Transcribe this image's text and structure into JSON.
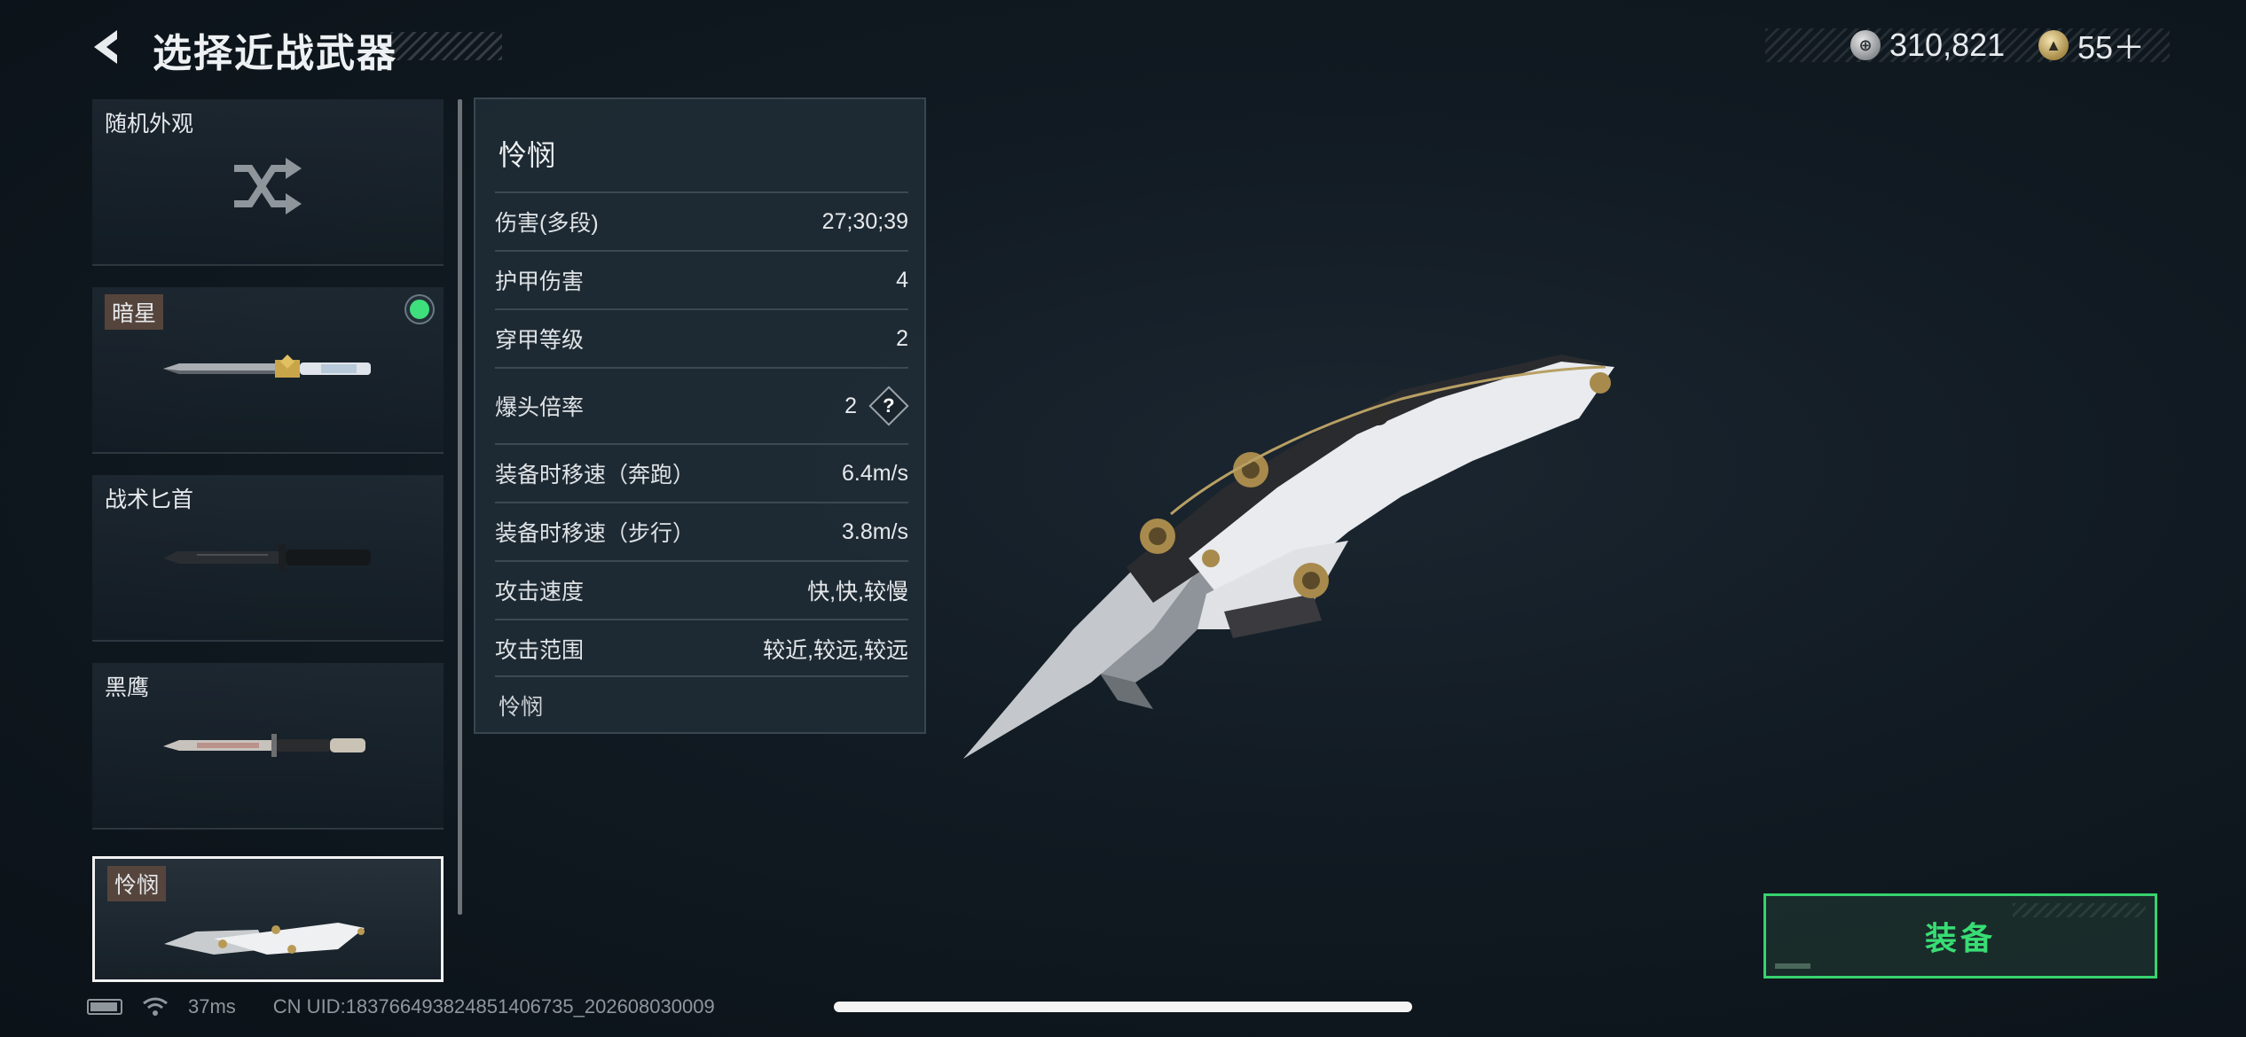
{
  "header": {
    "title": "选择近战武器",
    "back_icon": "chevron-left-icon"
  },
  "currency": [
    {
      "icon": "coin-icon",
      "glyph": "⊕",
      "value": "310,821"
    },
    {
      "icon": "token-icon",
      "glyph": "▲",
      "value": "55＋"
    }
  ],
  "weapons": [
    {
      "label": "随机外观",
      "icon": "shuffle-icon"
    },
    {
      "label": "暗星",
      "equipped": true
    },
    {
      "label": "战术匕首"
    },
    {
      "label": "黑鹰"
    },
    {
      "label": "怜悯",
      "selected": true
    }
  ],
  "stats": {
    "title": "怜悯",
    "rows": [
      {
        "label": "伤害(多段)",
        "value": "27;30;39"
      },
      {
        "label": "护甲伤害",
        "value": "4"
      },
      {
        "label": "穿甲等级",
        "value": "2"
      },
      {
        "label": "爆头倍率",
        "value": "2",
        "help": "?"
      },
      {
        "label": "装备时移速（奔跑）",
        "value": "6.4m/s"
      },
      {
        "label": "装备时移速（步行）",
        "value": "3.8m/s"
      },
      {
        "label": "攻击速度",
        "value": "快,快,较慢"
      },
      {
        "label": "攻击范围",
        "value": "较近,较远,较远"
      }
    ],
    "description": "怜悯"
  },
  "equip_button": {
    "label": "装备",
    "color": "#38dd74"
  },
  "status": {
    "ping": "37ms",
    "uid": "CN UID:18376649382485140673​5_202608030009"
  }
}
